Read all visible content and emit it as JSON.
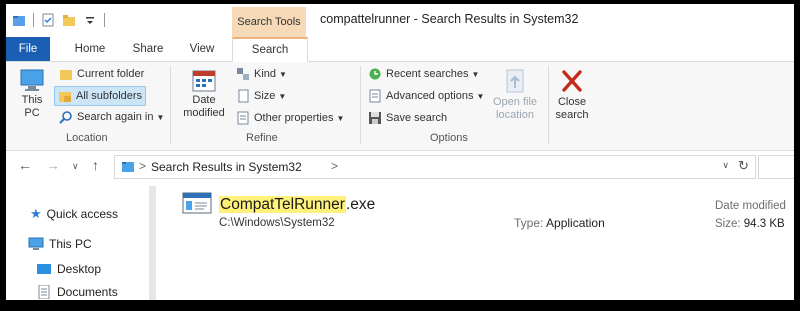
{
  "window": {
    "context_tab": "Search Tools",
    "title": "compattelrunner - Search Results in System32"
  },
  "tabs": [
    "File",
    "Home",
    "Share",
    "View",
    "Search"
  ],
  "ribbon": {
    "this_pc": {
      "line1": "This",
      "line2": "PC"
    },
    "current_folder": "Current folder",
    "all_subfolders": "All subfolders",
    "search_again_in": "Search again in",
    "location_label": "Location",
    "date_modified": {
      "line1": "Date",
      "line2": "modified"
    },
    "kind": "Kind",
    "size": "Size",
    "other_properties": "Other properties",
    "refine_label": "Refine",
    "recent_searches": "Recent searches",
    "advanced_options": "Advanced options",
    "save_search": "Save search",
    "options_label": "Options",
    "open_file_location": {
      "line1": "Open file",
      "line2": "location"
    },
    "close_search": {
      "line1": "Close",
      "line2": "search"
    }
  },
  "address": {
    "path": "Search Results in System32",
    "sep": ">"
  },
  "nav": {
    "quick_access": "Quick access",
    "this_pc": "This PC",
    "desktop": "Desktop",
    "documents": "Documents"
  },
  "result": {
    "name_match": "CompatTelRunner",
    "name_ext": ".exe",
    "path": "C:\\Windows\\System32",
    "type_key": "Type:",
    "type_value": "Application",
    "date_key": "Date modified",
    "size_key": "Size:",
    "size_value": "94.3 KB"
  },
  "colors": {
    "file_tab": "#1a5fb4",
    "context_tab": "#f6d9b7",
    "match_highlight": "#fff17a",
    "close_x": "#c42b1c"
  }
}
